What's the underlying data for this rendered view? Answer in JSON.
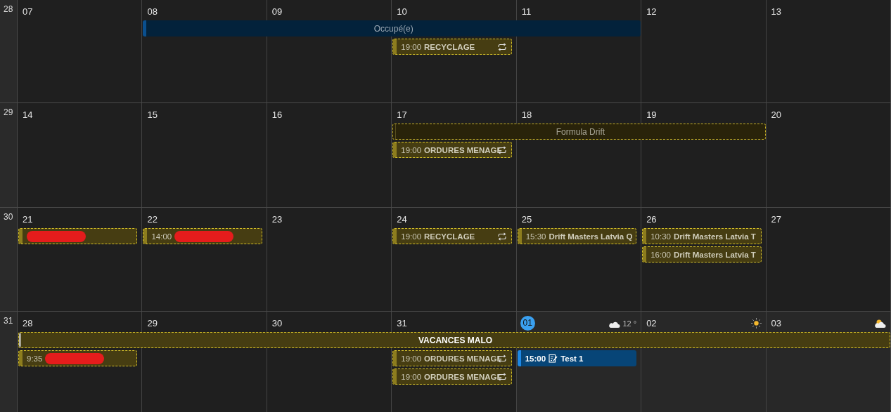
{
  "weeks": [
    {
      "number": "28",
      "days": [
        {
          "label": "07",
          "today": false
        },
        {
          "label": "08",
          "today": false,
          "banner": {
            "title": "Occupé(e)",
            "kind": "busy"
          }
        },
        {
          "label": "09",
          "today": false
        },
        {
          "label": "10",
          "today": false,
          "events": [
            {
              "time": "19:00",
              "title": "RECYCLAGE",
              "kind": "tentative",
              "recurring": true
            }
          ]
        },
        {
          "label": "11",
          "today": false,
          "banner_end": true
        },
        {
          "label": "12",
          "today": false
        },
        {
          "label": "13",
          "today": false
        }
      ]
    },
    {
      "number": "29",
      "days": [
        {
          "label": "14",
          "today": false
        },
        {
          "label": "15",
          "today": false
        },
        {
          "label": "16",
          "today": false
        },
        {
          "label": "17",
          "today": false,
          "banner": {
            "title": "Formula Drift",
            "kind": "tentative-dim"
          },
          "events": [
            {
              "time": "19:00",
              "title": "ORDURES MENAGE",
              "kind": "tentative",
              "recurring": true
            }
          ]
        },
        {
          "label": "18",
          "today": false
        },
        {
          "label": "19",
          "today": false,
          "banner_end": true
        },
        {
          "label": "20",
          "today": false
        }
      ]
    },
    {
      "number": "30",
      "days": [
        {
          "label": "21",
          "today": false,
          "events": [
            {
              "kind": "tentative",
              "redacted": true
            }
          ]
        },
        {
          "label": "22",
          "today": false,
          "events": [
            {
              "time": "14:00",
              "kind": "tentative",
              "redacted": true
            }
          ]
        },
        {
          "label": "23",
          "today": false
        },
        {
          "label": "24",
          "today": false,
          "events": [
            {
              "time": "19:00",
              "title": "RECYCLAGE",
              "kind": "tentative",
              "recurring": true
            }
          ]
        },
        {
          "label": "25",
          "today": false,
          "events": [
            {
              "time": "15:30",
              "title": "Drift Masters Latvia Q",
              "kind": "tentative"
            }
          ]
        },
        {
          "label": "26",
          "today": false,
          "events": [
            {
              "time": "10:30",
              "title": "Drift Masters Latvia T",
              "kind": "tentative"
            },
            {
              "time": "16:00",
              "title": "Drift Masters Latvia T",
              "kind": "tentative"
            }
          ]
        },
        {
          "label": "27",
          "today": false
        }
      ]
    },
    {
      "number": "31",
      "days": [
        {
          "label": "28",
          "today": false,
          "banner": {
            "title": "VACANCES MALO",
            "kind": "tentative-bold"
          },
          "events": [
            {
              "time": "9:35",
              "kind": "tentative",
              "redacted": true
            }
          ]
        },
        {
          "label": "29",
          "today": false
        },
        {
          "label": "30",
          "today": false
        },
        {
          "label": "31",
          "today": false,
          "events": [
            {
              "time": "19:00",
              "title": "ORDURES MENAGE",
              "kind": "tentative",
              "recurring": true
            },
            {
              "time": "19:00",
              "title": "ORDURES MENAGE",
              "kind": "tentative",
              "recurring": true
            }
          ]
        },
        {
          "label": "01",
          "other_month": true,
          "today": true,
          "weather": {
            "kind": "night-cloud",
            "temp": "12 °"
          },
          "events": [
            {
              "time": "15:00",
              "title": "Test 1",
              "kind": "appointment",
              "note": true
            }
          ]
        },
        {
          "label": "02",
          "other_month": true,
          "today": false,
          "weather": {
            "kind": "sun"
          }
        },
        {
          "label": "03",
          "other_month": true,
          "today": false,
          "weather": {
            "kind": "sun-cloud"
          },
          "banner_end": true
        }
      ]
    }
  ]
}
